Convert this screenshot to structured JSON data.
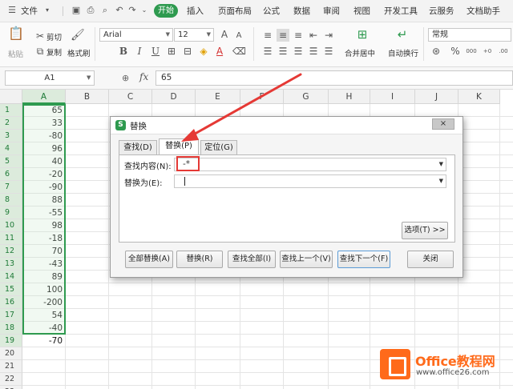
{
  "menubar": {
    "file_label": "文件",
    "start_label": "开始",
    "tabs": [
      "插入",
      "页面布局",
      "公式",
      "数据",
      "审阅",
      "视图",
      "开发工具",
      "云服务",
      "文档助手"
    ]
  },
  "ribbon": {
    "paste_label": "粘贴",
    "cut_label": "剪切",
    "copy_label": "复制",
    "format_painter_label": "格式刷",
    "font_name": "Arial",
    "font_size": "12",
    "merge_label": "合并居中",
    "wrap_label": "自动换行",
    "number_format": "常规",
    "bold_glyph": "B",
    "italic_glyph": "I",
    "underline_glyph": "U",
    "grow_glyph": "A",
    "shrink_glyph": "A",
    "font_color_glyph": "A",
    "percent_glyph": "%",
    "comma_glyph": "000",
    "dec_inc_glyph": "+0",
    "dec_dec_glyph": ".00"
  },
  "formula_bar": {
    "cell_ref": "A1",
    "fx_label": "fx",
    "value": "65"
  },
  "sheet": {
    "columns": [
      "A",
      "B",
      "C",
      "D",
      "E",
      "F",
      "G",
      "H",
      "I",
      "J",
      "K"
    ],
    "rows": [
      "1",
      "2",
      "3",
      "4",
      "5",
      "6",
      "7",
      "8",
      "9",
      "10",
      "11",
      "12",
      "13",
      "14",
      "15",
      "16",
      "17",
      "18",
      "19",
      "20",
      "21",
      "22",
      "23"
    ],
    "column_a_values": [
      "65",
      "33",
      "-80",
      "96",
      "40",
      "-20",
      "-90",
      "88",
      "-55",
      "98",
      "-18",
      "70",
      "-43",
      "89",
      "100",
      "-200",
      "54",
      "-40",
      "-70"
    ]
  },
  "dialog": {
    "title": "替换",
    "logo_glyph": "S",
    "close_glyph": "×",
    "tabs": [
      "查找(D)",
      "替换(P)",
      "定位(G)"
    ],
    "find_label": "查找内容(N):",
    "find_value": "-*",
    "replace_label": "替换为(E):",
    "replace_value": "",
    "options_button": "选项(T) >>",
    "buttons": [
      "全部替换(A)",
      "替换(R)",
      "查找全部(I)",
      "查找上一个(V)",
      "查找下一个(F)",
      "关闭"
    ]
  },
  "watermark": {
    "title": "Office教程网",
    "url": "www.office26.com"
  },
  "colors": {
    "accent_green": "#2e9a4f",
    "annotation_red": "#e53935",
    "watermark_orange": "#ff6a1a"
  }
}
